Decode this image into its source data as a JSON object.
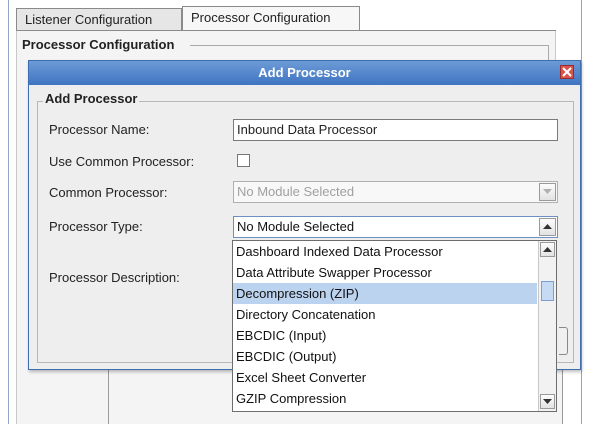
{
  "tabs": [
    {
      "label": "Listener Configuration",
      "active": false
    },
    {
      "label": "Processor Configuration",
      "active": true
    }
  ],
  "panel": {
    "group_title": "Processor Configuration"
  },
  "dialog": {
    "title": "Add Processor",
    "legend": "Add Processor",
    "fields": {
      "processor_name": {
        "label": "Processor Name:",
        "value": "Inbound Data Processor"
      },
      "use_common": {
        "label": "Use Common Processor:",
        "checked": false
      },
      "common_processor": {
        "label": "Common Processor:",
        "value": "No Module Selected",
        "enabled": false
      },
      "processor_type": {
        "label": "Processor Type:",
        "value": "No Module Selected"
      },
      "processor_description": {
        "label": "Processor Description:"
      }
    }
  },
  "dropdown": {
    "items": [
      "Dashboard Indexed Data Processor",
      "Data Attribute Swapper Processor",
      "Decompression (ZIP)",
      "Directory Concatenation",
      "EBCDIC (Input)",
      "EBCDIC (Output)",
      "Excel Sheet Converter",
      "GZIP Compression"
    ],
    "highlighted": "Decompression (ZIP)"
  },
  "colors": {
    "titlebar": "#4a7fc8",
    "highlight": "#bcd3ef",
    "close": "#d9534f"
  },
  "icons": [
    "close-icon",
    "chevron-down-icon",
    "chevron-up-icon"
  ]
}
